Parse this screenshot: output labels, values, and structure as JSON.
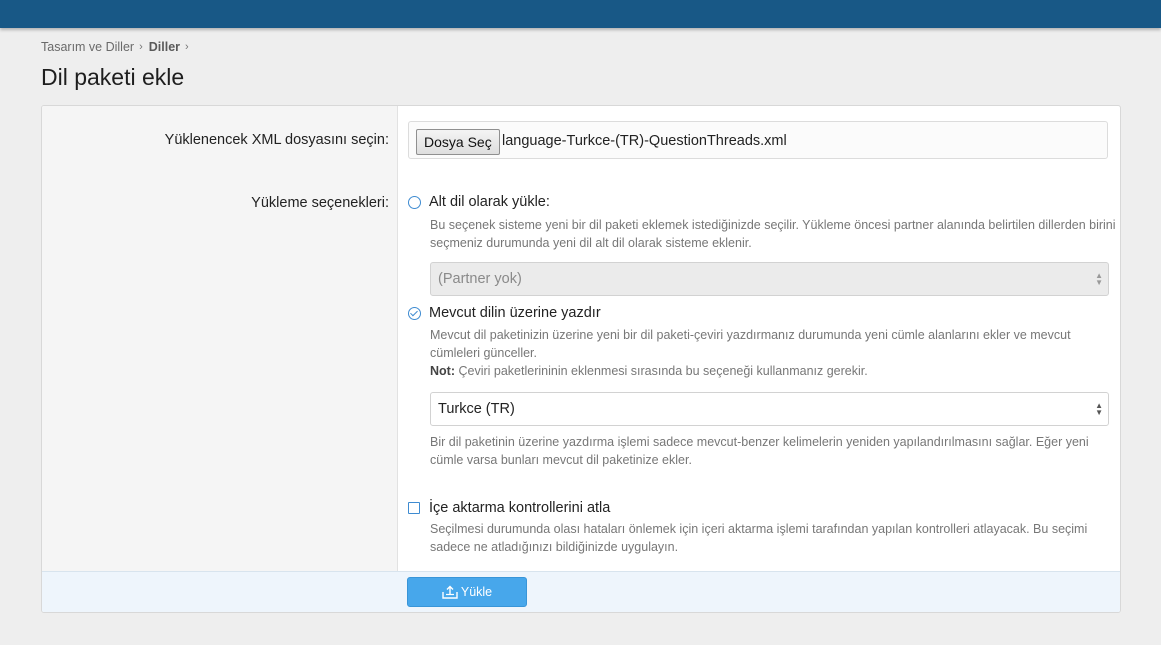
{
  "breadcrumb": {
    "items": [
      "Tasarım ve Diller",
      "Diller"
    ],
    "separator": "›"
  },
  "page": {
    "title": "Dil paketi ekle"
  },
  "form": {
    "file_label": "Yüklenencek XML dosyasını seçin:",
    "file_button": "Dosya Seç",
    "file_name": "language-Turkce-(TR)-QuestionThreads.xml",
    "options_label": "Yükleme seçenekleri:",
    "option_child": {
      "label": "Alt dil olarak yükle:",
      "hint": "Bu seçenek sisteme yeni bir dil paketi eklemek istediğinizde seçilir. Yükleme öncesi partner alanında belirtilen dillerden birini seçmeniz durumunda yeni dil alt dil olarak sisteme eklenir.",
      "select_value": "(Partner yok)",
      "checked": false
    },
    "option_overwrite": {
      "label": "Mevcut dilin üzerine yazdır",
      "hint": "Mevcut dil paketinizin üzerine yeni bir dil paketi-çeviri yazdırmanız durumunda yeni cümle alanlarını ekler ve mevcut cümleleri günceller.",
      "note_prefix": "Not:",
      "note": " Çeviri paketlerininin eklenmesi sırasında bu seçeneği kullanmanız gerekir.",
      "select_value": "Turkce (TR)",
      "after_hint": "Bir dil paketinin üzerine yazdırma işlemi sadece mevcut-benzer kelimelerin yeniden yapılandırılmasını sağlar. Eğer yeni cümle varsa bunları mevcut dil paketinize ekler.",
      "checked": true
    },
    "option_skip": {
      "label": "İçe aktarma kontrollerini atla",
      "hint": "Seçilmesi durumunda olası hataları önlemek için içeri aktarma işlemi tarafından yapılan kontrolleri atlayacak. Bu seçimi sadece ne atladığınızı bildiğinizde uygulayın.",
      "checked": false
    },
    "submit_label": "Yükle"
  },
  "colors": {
    "topbar": "#185886",
    "accent": "#47a7eb",
    "control": "#3e8bd1"
  },
  "icons": {
    "submit": "upload-icon",
    "breadcrumb_sep": "chevron-right-icon"
  }
}
